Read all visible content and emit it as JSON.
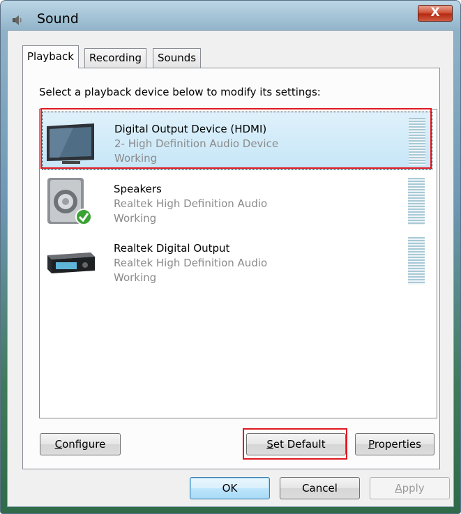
{
  "window": {
    "title": "Sound",
    "close_glyph": "X"
  },
  "tabs": [
    {
      "label": "Playback",
      "active": true
    },
    {
      "label": "Recording",
      "active": false
    },
    {
      "label": "Sounds",
      "active": false
    }
  ],
  "instruction": "Select a playback device below to modify its settings:",
  "devices": [
    {
      "name": "Digital Output Device (HDMI)",
      "description": "2- High Definition Audio Device",
      "status": "Working",
      "icon": "monitor-icon",
      "selected": true,
      "is_default": false
    },
    {
      "name": "Speakers",
      "description": "Realtek High Definition Audio",
      "status": "Working",
      "icon": "speaker-icon",
      "selected": false,
      "is_default": true
    },
    {
      "name": "Realtek Digital Output",
      "description": "Realtek High Definition Audio",
      "status": "Working",
      "icon": "receiver-icon",
      "selected": false,
      "is_default": false
    }
  ],
  "panel_buttons": {
    "configure": {
      "access_key": "C",
      "rest": "onfigure"
    },
    "set_default": {
      "access_key": "S",
      "rest": "et Default"
    },
    "properties": {
      "access_key": "P",
      "rest": "roperties"
    }
  },
  "dialog_buttons": {
    "ok": "OK",
    "cancel": "Cancel",
    "apply": {
      "access_key": "A",
      "rest": "pply",
      "disabled": true
    }
  },
  "colors": {
    "highlight_box": "#e0181f",
    "selected_row": "#c6e6f7",
    "default_check": "#3aa335"
  }
}
